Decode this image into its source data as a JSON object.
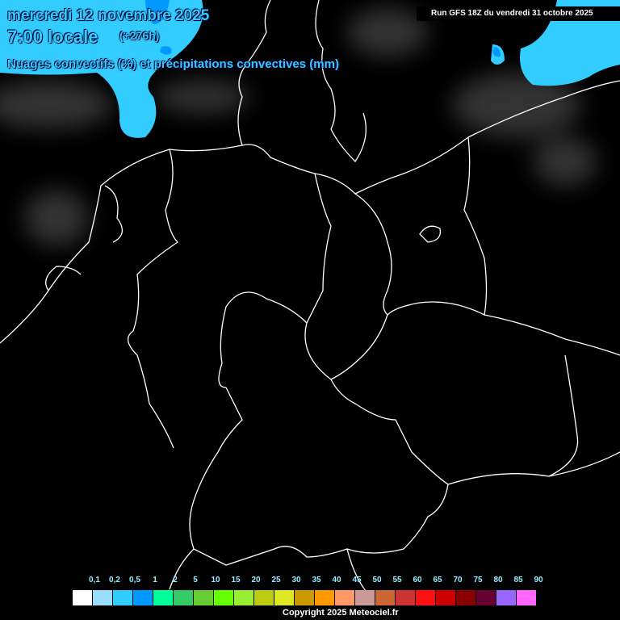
{
  "header": {
    "date": "mercredi 12 novembre 2025",
    "time": "7:00 locale",
    "lead": "(+276h)",
    "parameter": "Nuages convectifs (%) et précipitations convectives (mm)",
    "run": "Run GFS 18Z du vendredi 31 octobre 2025"
  },
  "legend": {
    "labels": [
      "0,1",
      "0,2",
      "0,5",
      "1",
      "2",
      "5",
      "10",
      "15",
      "20",
      "25",
      "30",
      "35",
      "40",
      "45",
      "50",
      "55",
      "60",
      "65",
      "70",
      "75",
      "80",
      "85",
      "90"
    ],
    "colors": [
      "#ffffff",
      "#99ddff",
      "#33ccff",
      "#0099ff",
      "#00ff99",
      "#33cc66",
      "#66cc33",
      "#66ff00",
      "#99ee33",
      "#bbcc11",
      "#dde822",
      "#cc9900",
      "#ff9900",
      "#ff9966",
      "#cc9999",
      "#cc6633",
      "#cc3333",
      "#ff1111",
      "#cc0000",
      "#880000",
      "#660033",
      "#9966ff",
      "#ff66ff"
    ]
  },
  "footer": {
    "copyright": "Copyright 2025 Meteociel.fr"
  },
  "colors": {
    "precip_light": "#33ccff",
    "precip_medium": "#0099ff",
    "title": "#33ccff"
  }
}
